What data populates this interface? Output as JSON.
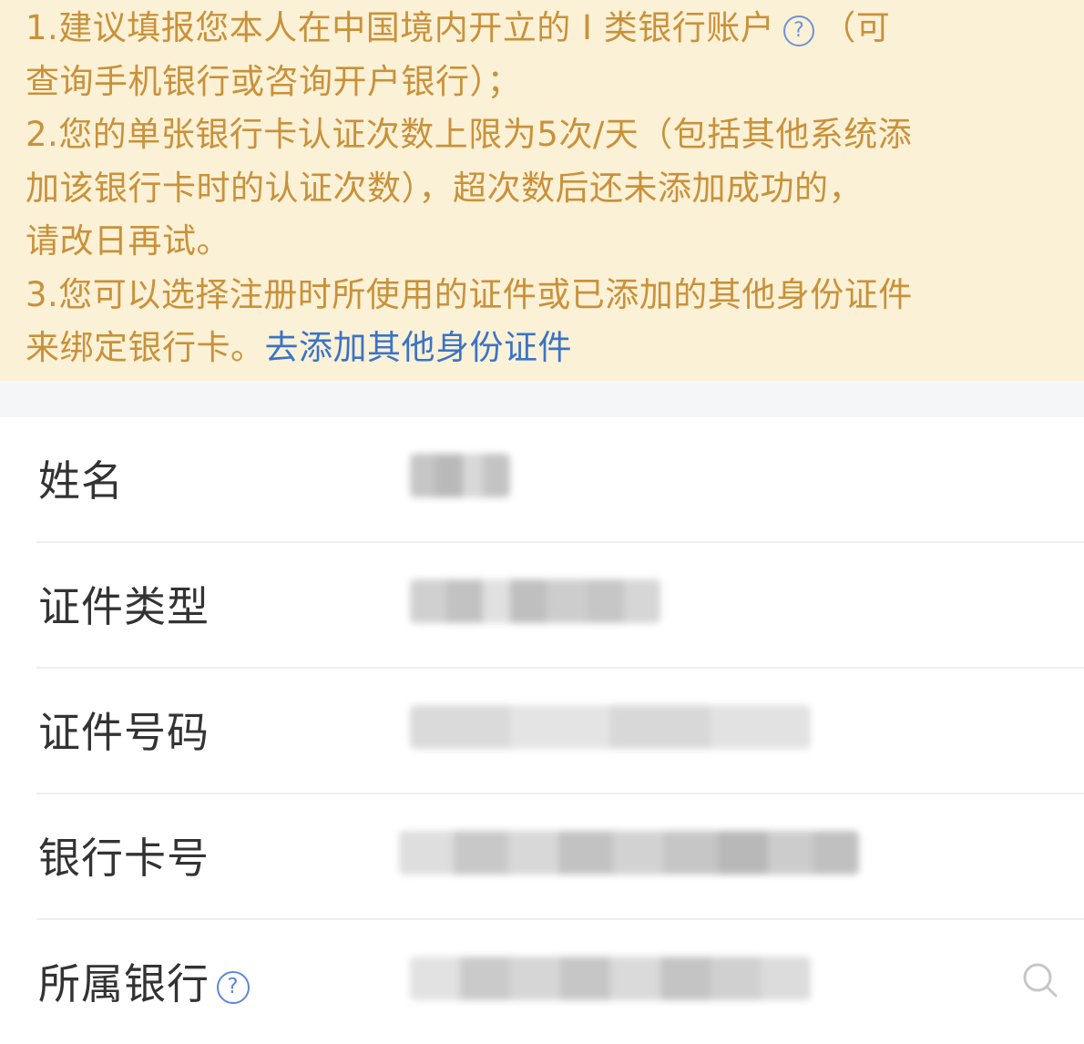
{
  "notice": {
    "line1": "1.建议填报您本人在中国境内开立的 I 类银行账户",
    "line1_help_glyph": "?",
    "line1_tail": "（可",
    "line2": "查询手机银行或咨询开户银行）；",
    "line3": "2.您的单张银行卡认证次数上限为5次/天（包括其他系统添",
    "line4": "加该银行卡时的认证次数），超次数后还未添加成功的，",
    "line5": "请改日再试。",
    "line6": "3.您可以选择注册时所使用的证件或已添加的其他身份证件",
    "line7_prefix": "来绑定银行卡。",
    "line7_link": "去添加其他身份证件"
  },
  "form": {
    "name_label": "姓名",
    "id_type_label": "证件类型",
    "id_number_label": "证件号码",
    "card_number_label": "银行卡号",
    "bank_label": "所属银行",
    "bank_help_glyph": "?"
  },
  "icons": {
    "help": "help-circle-icon",
    "search": "search-icon"
  },
  "colors": {
    "notice_bg": "#fbf1d6",
    "notice_text": "#c9913a",
    "link": "#3b73c6",
    "label_text": "#333333"
  }
}
